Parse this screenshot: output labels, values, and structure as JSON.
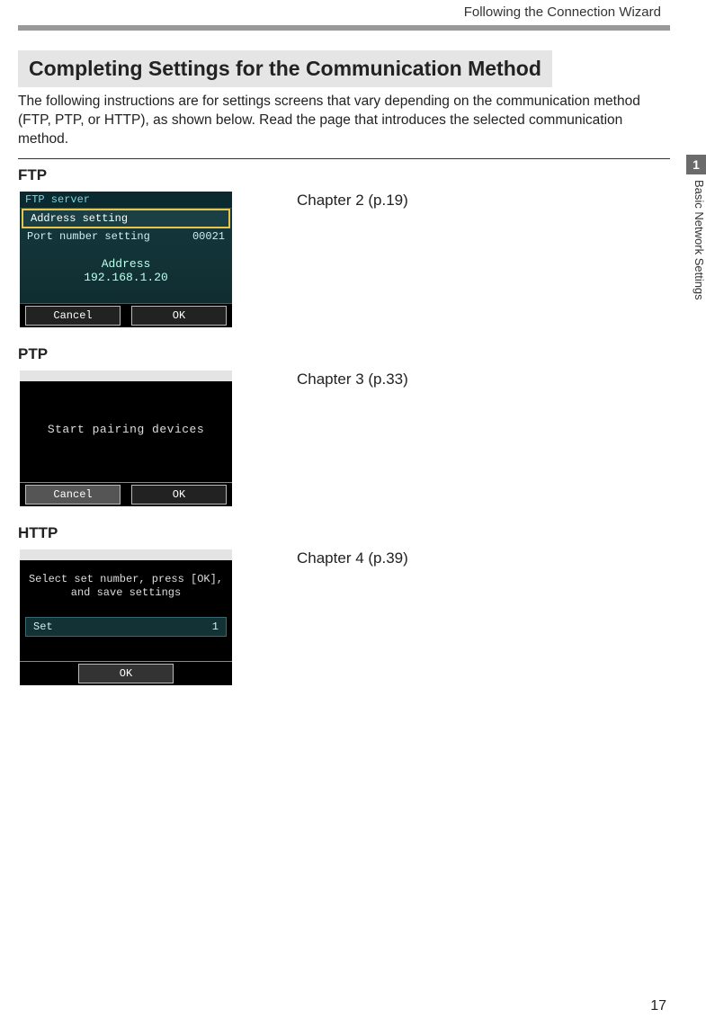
{
  "running_header": "Following the Connection Wizard",
  "section_title": "Completing Settings for the Communication Method",
  "intro_text": "The following instructions are for settings screens that vary depending on the communication method (FTP, PTP, or HTTP), as shown below. Read the page that introduces the selected communication method.",
  "side_tab_number": "1",
  "side_tab_label": "Basic Network Settings",
  "page_number": "17",
  "ftp": {
    "heading": "FTP",
    "chapter_ref": "Chapter 2 (p.19)",
    "screen": {
      "title": "FTP server",
      "row1_label": "Address setting",
      "row2_label": "Port number setting",
      "row2_value": "00021",
      "address_label": "Address",
      "address_value": "192.168.1.20",
      "btn_cancel": "Cancel",
      "btn_ok": "OK"
    }
  },
  "ptp": {
    "heading": "PTP",
    "chapter_ref": "Chapter 3 (p.33)",
    "screen": {
      "message": "Start pairing devices",
      "btn_cancel": "Cancel",
      "btn_ok": "OK"
    }
  },
  "http": {
    "heading": "HTTP",
    "chapter_ref": "Chapter 4 (p.39)",
    "screen": {
      "message_line1": "Select set number, press [OK],",
      "message_line2": "and save settings",
      "set_label": "Set",
      "set_value": "1",
      "btn_ok": "OK"
    }
  }
}
